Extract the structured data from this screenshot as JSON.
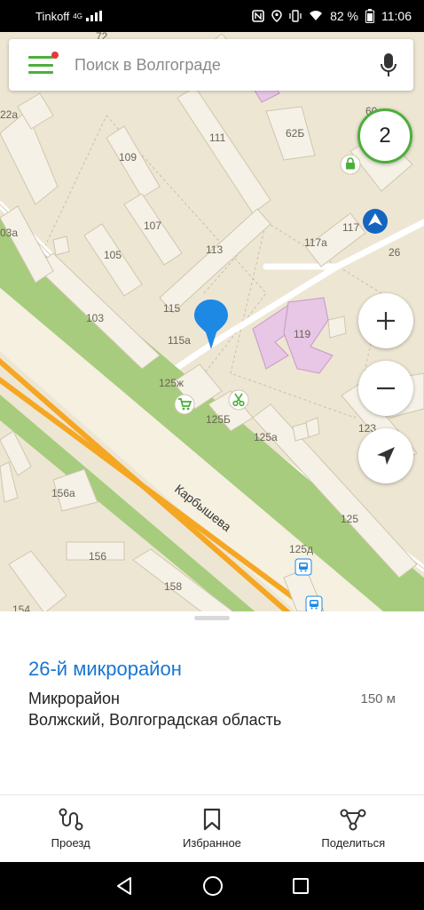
{
  "status_bar": {
    "carrier": "Tinkoff",
    "network": "4G",
    "battery": "82 %",
    "time": "11:06"
  },
  "search": {
    "placeholder": "Поиск в Волгограде"
  },
  "map": {
    "badge_count": "2",
    "street_name": "Карбышева",
    "building_numbers": [
      "111",
      "62Б",
      "109",
      "107",
      "105",
      "103",
      "113",
      "115",
      "115а",
      "117а",
      "117",
      "26",
      "119",
      "125ж",
      "125Б",
      "125а",
      "123",
      "125",
      "125д",
      "156а",
      "156",
      "158",
      "154",
      "22а",
      "03а",
      "72",
      "60"
    ],
    "icons": [
      "lock-icon",
      "navigation-arrow-icon",
      "shopping-cart-icon",
      "scissors-icon",
      "bus-stop-icon",
      "location-pin-icon"
    ]
  },
  "place": {
    "title": "26-й микрорайон",
    "type": "Микрорайон",
    "address": "Волжский, Волгоградская область",
    "distance": "150 м"
  },
  "actions": [
    {
      "label": "Проезд",
      "icon": "route-icon"
    },
    {
      "label": "Избранное",
      "icon": "bookmark-icon"
    },
    {
      "label": "Поделиться",
      "icon": "share-icon"
    }
  ],
  "controls": {
    "zoom_in": "+",
    "zoom_out": "−"
  },
  "colors": {
    "accent_green": "#4caf3a",
    "title_blue": "#1976d2",
    "pin_blue": "#1e88e5",
    "road_yellow": "#f5a623"
  }
}
